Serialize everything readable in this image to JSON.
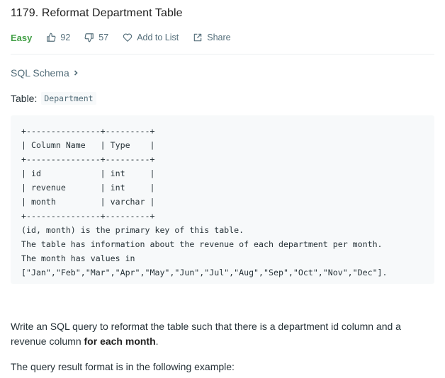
{
  "problem": {
    "title": "1179. Reformat Department Table",
    "difficulty": "Easy",
    "likes": "92",
    "dislikes": "57",
    "add_to_list": "Add to List",
    "share": "Share",
    "difficulty_color": "#43a047"
  },
  "schema_link": "SQL Schema",
  "table_label": "Table:",
  "table_name": "Department",
  "schema_block": "+---------------+---------+\n| Column Name   | Type    |\n+---------------+---------+\n| id            | int     |\n| revenue       | int     |\n| month         | varchar |\n+---------------+---------+\n(id, month) is the primary key of this table.\nThe table has information about the revenue of each department per month.\nThe month has values in\n[\"Jan\",\"Feb\",\"Mar\",\"Apr\",\"May\",\"Jun\",\"Jul\",\"Aug\",\"Sep\",\"Oct\",\"Nov\",\"Dec\"].",
  "description": {
    "part1": "Write an SQL query to reformat the table such that there is a department id column and a revenue column ",
    "bold": "for each month",
    "part2": "."
  },
  "result_format": "The query result format is in the following example:",
  "icons": {
    "like": "thumbs-up-icon",
    "dislike": "thumbs-down-icon",
    "add_to_list": "heart-icon",
    "share": "share-icon",
    "schema": "chevron-right-icon"
  }
}
